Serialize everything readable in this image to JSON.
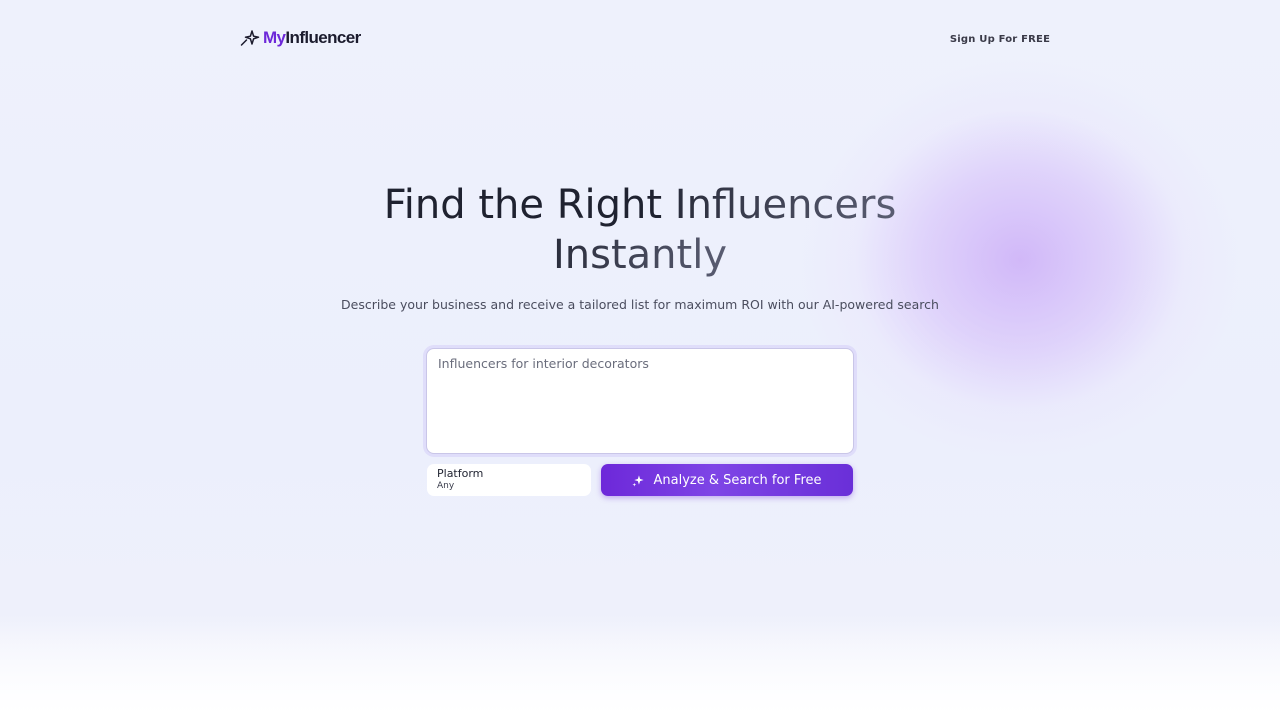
{
  "header": {
    "logo_prefix": "My",
    "logo_suffix": "Influencer",
    "logo_icon": "sparkle-star-icon",
    "signup_label": "Sign Up For FREE"
  },
  "hero": {
    "title_part1": "Find the Right ",
    "title_part2": "Influencers",
    "title_part3": "Instantly",
    "subtitle": "Describe your business and receive a tailored list for maximum ROI with our AI-powered search"
  },
  "search": {
    "placeholder": "Influencers for interior decorators"
  },
  "platform": {
    "label": "Platform",
    "value": "Any"
  },
  "analyze": {
    "label": "Analyze & Search for Free",
    "icon": "sparkles-icon"
  },
  "colors": {
    "accent": "#6d28d9",
    "background": "#eef1fc"
  }
}
